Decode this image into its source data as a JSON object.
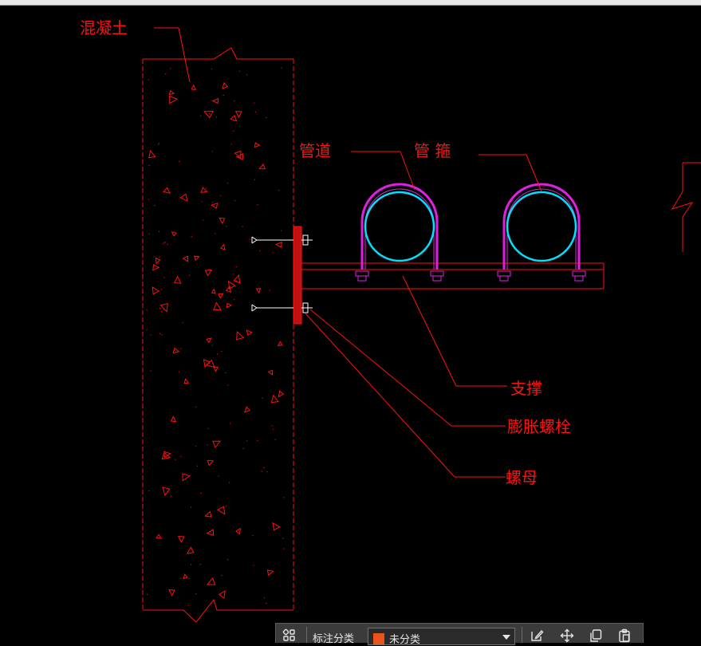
{
  "drawing": {
    "labels": {
      "concrete": "混凝土",
      "pipe": "管道",
      "pipe_clamp": "管 箍",
      "support": "支撑",
      "expansion_bolt": "膨胀螺栓",
      "nut": "螺母"
    },
    "colors": {
      "background": "#000000",
      "annotation": "#ff1010",
      "pipe": "#00e0ff",
      "clamp": "#e020e0"
    }
  },
  "toolbar": {
    "grid_icon": "four-squares-icon",
    "category_label": "标注分类",
    "category_value": "未分类",
    "category_swatch_color": "#e8541a",
    "icons": [
      "edit-icon",
      "move-icon",
      "copy-icon",
      "paste-icon"
    ]
  }
}
